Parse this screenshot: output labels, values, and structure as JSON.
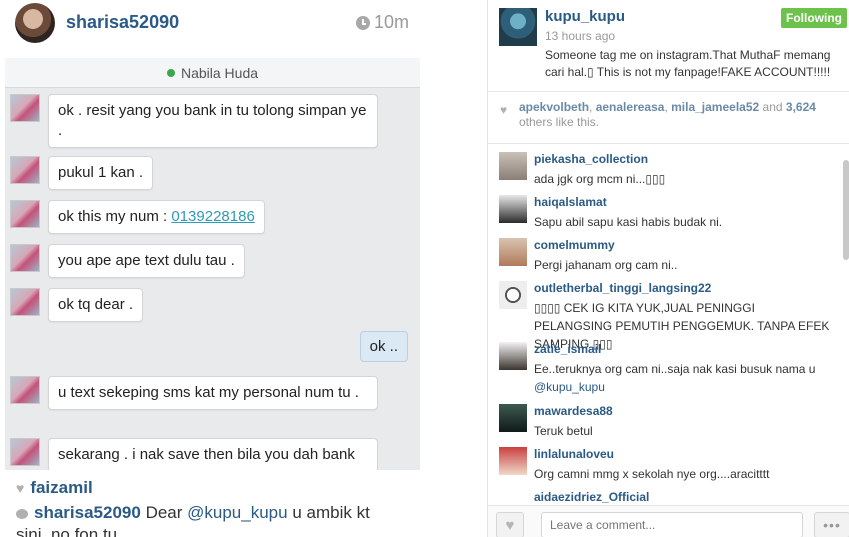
{
  "left_post": {
    "username": "sharisa52090",
    "time": "10m",
    "chat": {
      "contact_name": "Nabila Huda",
      "messages": [
        {
          "text": "ok . resit yang you bank in tu tolong simpan ye ."
        },
        {
          "text": "pukul 1 kan ."
        },
        {
          "prefix": "ok this my num : ",
          "number": "0139228186"
        },
        {
          "text": "you ape ape text dulu tau ."
        },
        {
          "text": "ok tq dear ."
        },
        {
          "text": "u text sekeping sms kat my personal num tu ."
        },
        {
          "text": "sekarang . i nak save then bila you dah bank"
        }
      ],
      "reply": "ok .."
    },
    "likes_user": "faizamil",
    "comment": {
      "user": "sharisa52090",
      "text_before": "Dear ",
      "mention": "@kupu_kupu",
      "text_after": "  u ambik kt sini..no fon tu .."
    }
  },
  "right_post": {
    "username": "kupu_kupu",
    "time": "13 hours ago",
    "follow_label": "Following",
    "caption": "Someone tag me on instagram.That MuthaF memang cari hal.▯ This is not my fanpage!FAKE ACCOUNT!!!!!",
    "likes": {
      "users": [
        "apekvolbeth",
        "aenalereasa",
        "mila_jameela52"
      ],
      "and_label": "and",
      "count": "3,624",
      "suffix": "others like this."
    },
    "comments": [
      {
        "user": "piekasha_collection",
        "text": "ada jgk org mcm ni...▯▯▯"
      },
      {
        "user": "haiqalslamat",
        "text": "Sapu abil sapu kasi habis budak ni."
      },
      {
        "user": "comelmummy",
        "text": "Pergi jahanam org cam ni.."
      },
      {
        "user": "outletherbal_tinggi_langsing22",
        "text": "▯▯▯▯ CEK IG KITA YUK,JUAL PENINGGI PELANGSING PEMUTIH PENGGEMUK. TANPA EFEK SAMPING ▯▯▯"
      },
      {
        "user": "zatie_ismail",
        "text": "Ee..teruknya org cam ni..saja nak kasi busuk nama u ",
        "mention": "@kupu_kupu"
      },
      {
        "user": "mawardesa88",
        "text": "Teruk betul"
      },
      {
        "user": "linlalunaloveu",
        "text": "Org camni mmg x sekolah nye org....aracitttt"
      },
      {
        "user": "aidaezidriez_Official",
        "text": ""
      }
    ],
    "comment_placeholder": "Leave a comment...",
    "more_label": "•••"
  }
}
